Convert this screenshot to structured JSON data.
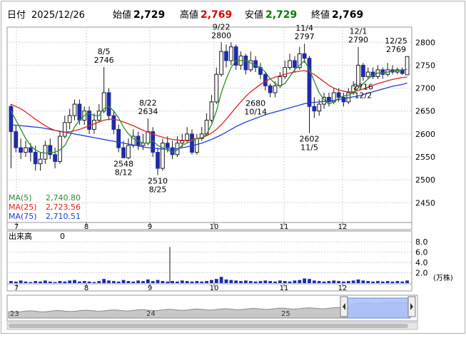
{
  "header": {
    "date_label": "日付",
    "date": "2025/12/26",
    "open_label": "始値",
    "open": "2,729",
    "high_label": "高値",
    "high": "2,769",
    "low_label": "安値",
    "low": "2,729",
    "close_label": "終値",
    "close": "2,769"
  },
  "colors": {
    "up": "#ffffff",
    "down": "#1f2aa8",
    "ma5": "#2e8b2e",
    "ma25": "#e02020",
    "ma75": "#2040d0",
    "high_text": "#e00000",
    "low_text": "#008000",
    "volume": "#1f2aa8",
    "panel_fill": "#a8c0ff"
  },
  "ma_legend": [
    {
      "label": "MA(5)",
      "value": "2,740.80"
    },
    {
      "label": "MA(25)",
      "value": "2,723.56"
    },
    {
      "label": "MA(75)",
      "value": "2,710.51"
    }
  ],
  "volume_panel": {
    "label": "出来高",
    "value": "0",
    "unit": "(万株)"
  },
  "navigator_labels": [
    "23",
    "24",
    "25"
  ],
  "chart_data": {
    "type": "candlestick",
    "x_tick_labels": [
      "7",
      "8",
      "9",
      "10",
      "11",
      "12"
    ],
    "y_ticks": [
      2450,
      2500,
      2550,
      2600,
      2650,
      2700,
      2750,
      2800
    ],
    "ylim": [
      2410,
      2830
    ],
    "volume_ticks": [
      "2.0",
      "4.0",
      "6.0",
      "8.0"
    ],
    "volume_ylim": [
      0,
      9
    ],
    "annotations": [
      {
        "date": "8/5",
        "value": "2746"
      },
      {
        "date": "8/22",
        "value": "2634"
      },
      {
        "date": "8/12",
        "value": "2548"
      },
      {
        "date": "8/25",
        "value": "2510"
      },
      {
        "date": "9/22",
        "value": "2800"
      },
      {
        "date": "10/14",
        "value": "2680"
      },
      {
        "date": "11/4",
        "value": "2797"
      },
      {
        "date": "11/5",
        "value": "2602"
      },
      {
        "date": "12/1",
        "value": "2790"
      },
      {
        "date": "12/2",
        "value": "2716"
      },
      {
        "date": "12/25",
        "value": "2769"
      }
    ],
    "candles": [
      [
        2660,
        2605,
        2665,
        2525
      ],
      [
        2605,
        2570,
        2620,
        2560
      ],
      [
        2570,
        2560,
        2590,
        2545
      ],
      [
        2560,
        2570,
        2585,
        2550
      ],
      [
        2570,
        2560,
        2580,
        2540
      ],
      [
        2560,
        2535,
        2575,
        2520
      ],
      [
        2535,
        2545,
        2560,
        2520
      ],
      [
        2545,
        2575,
        2585,
        2535
      ],
      [
        2575,
        2555,
        2590,
        2545
      ],
      [
        2555,
        2540,
        2570,
        2525
      ],
      [
        2540,
        2595,
        2605,
        2535
      ],
      [
        2595,
        2625,
        2640,
        2590
      ],
      [
        2625,
        2640,
        2655,
        2610
      ],
      [
        2640,
        2665,
        2675,
        2630
      ],
      [
        2665,
        2630,
        2675,
        2620
      ],
      [
        2630,
        2650,
        2660,
        2620
      ],
      [
        2650,
        2610,
        2660,
        2600
      ],
      [
        2610,
        2630,
        2645,
        2600
      ],
      [
        2630,
        2650,
        2665,
        2625
      ],
      [
        2650,
        2690,
        2746,
        2645
      ],
      [
        2690,
        2640,
        2700,
        2630
      ],
      [
        2640,
        2610,
        2650,
        2600
      ],
      [
        2610,
        2570,
        2620,
        2560
      ],
      [
        2570,
        2548,
        2585,
        2548
      ],
      [
        2548,
        2575,
        2590,
        2545
      ],
      [
        2575,
        2595,
        2610,
        2570
      ],
      [
        2595,
        2575,
        2605,
        2565
      ],
      [
        2575,
        2580,
        2600,
        2565
      ],
      [
        2580,
        2605,
        2634,
        2575
      ],
      [
        2605,
        2560,
        2615,
        2550
      ],
      [
        2560,
        2525,
        2570,
        2510
      ],
      [
        2525,
        2580,
        2590,
        2520
      ],
      [
        2580,
        2570,
        2595,
        2560
      ],
      [
        2570,
        2555,
        2585,
        2545
      ],
      [
        2555,
        2580,
        2595,
        2550
      ],
      [
        2580,
        2585,
        2600,
        2570
      ],
      [
        2585,
        2600,
        2615,
        2580
      ],
      [
        2600,
        2560,
        2610,
        2555
      ],
      [
        2560,
        2590,
        2600,
        2555
      ],
      [
        2590,
        2600,
        2615,
        2585
      ],
      [
        2600,
        2630,
        2645,
        2595
      ],
      [
        2630,
        2670,
        2685,
        2625
      ],
      [
        2670,
        2730,
        2745,
        2665
      ],
      [
        2730,
        2780,
        2800,
        2725
      ],
      [
        2780,
        2760,
        2795,
        2745
      ],
      [
        2760,
        2790,
        2800,
        2750
      ],
      [
        2790,
        2750,
        2795,
        2740
      ],
      [
        2750,
        2770,
        2780,
        2740
      ],
      [
        2770,
        2740,
        2775,
        2730
      ],
      [
        2740,
        2760,
        2780,
        2735
      ],
      [
        2760,
        2745,
        2770,
        2735
      ],
      [
        2745,
        2730,
        2755,
        2720
      ],
      [
        2730,
        2705,
        2735,
        2695
      ],
      [
        2705,
        2690,
        2710,
        2680
      ],
      [
        2690,
        2705,
        2715,
        2680
      ],
      [
        2705,
        2725,
        2735,
        2700
      ],
      [
        2725,
        2745,
        2760,
        2720
      ],
      [
        2745,
        2760,
        2775,
        2740
      ],
      [
        2760,
        2745,
        2770,
        2735
      ],
      [
        2745,
        2775,
        2790,
        2740
      ],
      [
        2775,
        2765,
        2797,
        2755
      ],
      [
        2765,
        2660,
        2770,
        2602
      ],
      [
        2660,
        2650,
        2680,
        2635
      ],
      [
        2650,
        2665,
        2675,
        2640
      ],
      [
        2665,
        2680,
        2690,
        2655
      ],
      [
        2680,
        2670,
        2690,
        2660
      ],
      [
        2670,
        2690,
        2700,
        2665
      ],
      [
        2690,
        2680,
        2700,
        2670
      ],
      [
        2680,
        2670,
        2690,
        2660
      ],
      [
        2670,
        2690,
        2700,
        2665
      ],
      [
        2690,
        2705,
        2715,
        2685
      ],
      [
        2705,
        2750,
        2790,
        2700
      ],
      [
        2750,
        2725,
        2755,
        2716
      ],
      [
        2725,
        2735,
        2745,
        2720
      ],
      [
        2735,
        2725,
        2745,
        2720
      ],
      [
        2725,
        2740,
        2750,
        2720
      ],
      [
        2740,
        2730,
        2745,
        2720
      ],
      [
        2730,
        2740,
        2755,
        2725
      ],
      [
        2740,
        2735,
        2750,
        2730
      ],
      [
        2735,
        2740,
        2745,
        2730
      ],
      [
        2740,
        2732,
        2745,
        2729
      ],
      [
        2729,
        2769,
        2769,
        2729
      ]
    ],
    "ma5": [
      2650,
      2630,
      2610,
      2590,
      2575,
      2565,
      2560,
      2558,
      2560,
      2560,
      2565,
      2575,
      2595,
      2615,
      2630,
      2640,
      2645,
      2640,
      2640,
      2655,
      2660,
      2650,
      2635,
      2615,
      2600,
      2590,
      2585,
      2580,
      2580,
      2585,
      2575,
      2570,
      2565,
      2560,
      2565,
      2575,
      2580,
      2585,
      2590,
      2590,
      2600,
      2620,
      2650,
      2690,
      2720,
      2745,
      2760,
      2760,
      2760,
      2755,
      2750,
      2745,
      2735,
      2720,
      2710,
      2705,
      2710,
      2725,
      2740,
      2750,
      2760,
      2740,
      2715,
      2690,
      2675,
      2665,
      2670,
      2678,
      2683,
      2685,
      2690,
      2700,
      2710,
      2720,
      2728,
      2733,
      2733,
      2735,
      2737,
      2738,
      2740,
      2741
    ],
    "ma25": [
      2665,
      2660,
      2655,
      2648,
      2640,
      2632,
      2625,
      2618,
      2612,
      2608,
      2605,
      2604,
      2605,
      2607,
      2610,
      2614,
      2618,
      2622,
      2626,
      2630,
      2632,
      2632,
      2630,
      2626,
      2622,
      2618,
      2613,
      2608,
      2604,
      2600,
      2596,
      2593,
      2590,
      2588,
      2587,
      2586,
      2586,
      2588,
      2590,
      2592,
      2596,
      2602,
      2610,
      2620,
      2632,
      2645,
      2658,
      2670,
      2682,
      2692,
      2700,
      2708,
      2715,
      2720,
      2724,
      2727,
      2730,
      2733,
      2735,
      2737,
      2738,
      2735,
      2730,
      2722,
      2714,
      2706,
      2700,
      2696,
      2693,
      2692,
      2692,
      2695,
      2698,
      2702,
      2706,
      2710,
      2713,
      2716,
      2719,
      2721,
      2723,
      2724
    ],
    "ma75": [
      2620,
      2619,
      2618,
      2617,
      2616,
      2615,
      2614,
      2612,
      2610,
      2608,
      2606,
      2604,
      2602,
      2600,
      2598,
      2596,
      2594,
      2592,
      2590,
      2588,
      2586,
      2584,
      2582,
      2580,
      2578,
      2576,
      2574,
      2572,
      2570,
      2569,
      2568,
      2567,
      2567,
      2567,
      2568,
      2570,
      2572,
      2574,
      2577,
      2580,
      2584,
      2588,
      2593,
      2598,
      2604,
      2610,
      2616,
      2621,
      2626,
      2630,
      2634,
      2638,
      2642,
      2645,
      2648,
      2651,
      2654,
      2657,
      2660,
      2663,
      2666,
      2668,
      2669,
      2670,
      2671,
      2672,
      2673,
      2675,
      2677,
      2679,
      2681,
      2683,
      2686,
      2689,
      2692,
      2695,
      2698,
      2701,
      2704,
      2706,
      2708,
      2711
    ],
    "volume": [
      0.4,
      0.3,
      0.5,
      0.3,
      0.2,
      0.4,
      0.3,
      0.5,
      0.3,
      0.2,
      0.4,
      0.3,
      0.5,
      0.6,
      0.3,
      0.4,
      0.3,
      0.2,
      0.4,
      0.8,
      0.5,
      0.4,
      0.3,
      0.6,
      0.4,
      0.3,
      0.5,
      0.4,
      0.7,
      0.4,
      0.6,
      0.4,
      0.3,
      0.4,
      0.3,
      0.5,
      0.4,
      0.3,
      0.4,
      0.3,
      0.4,
      0.6,
      0.8,
      1.2,
      0.7,
      0.6,
      0.5,
      0.4,
      0.5,
      0.4,
      0.3,
      0.4,
      0.5,
      0.4,
      0.3,
      0.5,
      0.4,
      0.3,
      0.5,
      0.6,
      0.9,
      0.8,
      0.5,
      0.4,
      0.3,
      0.4,
      0.5,
      0.4,
      0.3,
      0.4,
      0.5,
      0.7,
      0.5,
      0.4,
      0.3,
      0.4,
      0.3,
      0.4,
      0.3,
      0.4,
      0.3,
      0.5
    ],
    "volume_spike": 7.0
  }
}
